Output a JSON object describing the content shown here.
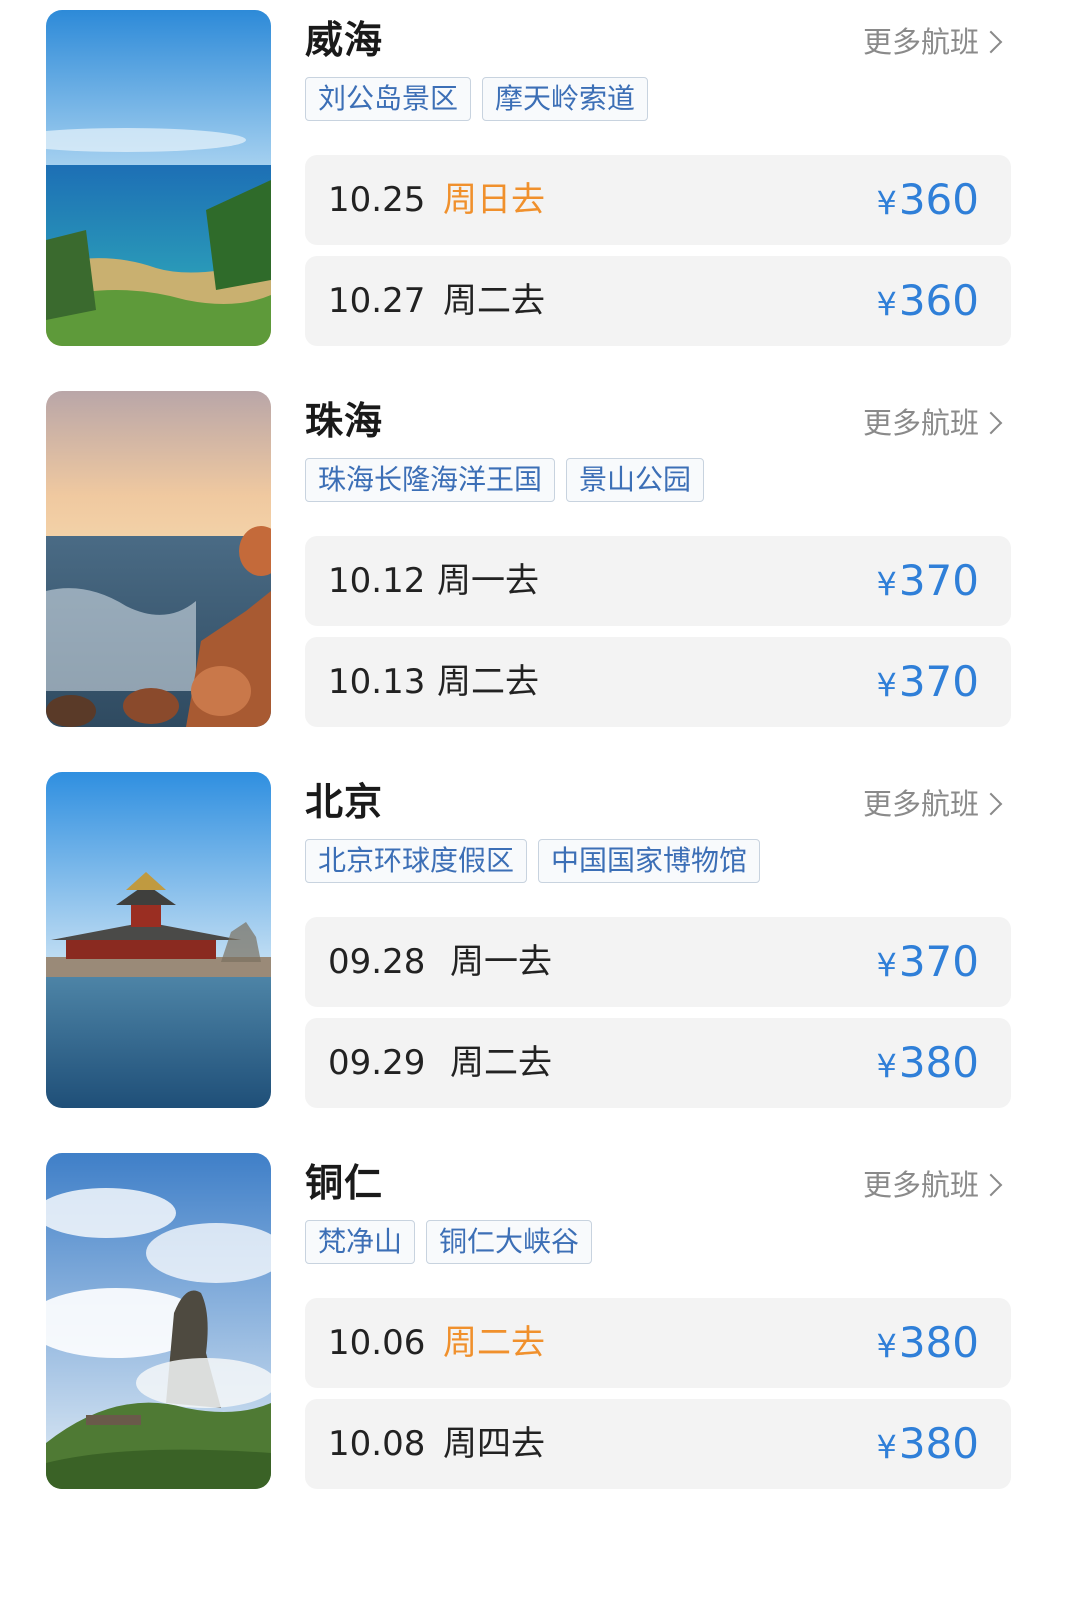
{
  "more_label": "更多航班",
  "colors": {
    "price": "#2f7fd8",
    "highlight_day": "#f0902c",
    "tag_text": "#3c6fb6"
  },
  "destinations": [
    {
      "city": "威海",
      "image": "seaside-coast-photo",
      "tags": [
        "刘公岛景区",
        "摩天岭索道"
      ],
      "flights": [
        {
          "date": "10.25",
          "day": "周日去",
          "highlight": true,
          "currency": "¥",
          "price": "360"
        },
        {
          "date": "10.27",
          "day": "周二去",
          "highlight": false,
          "currency": "¥",
          "price": "360"
        }
      ]
    },
    {
      "city": "珠海",
      "image": "rocky-shore-sunset-photo",
      "tags": [
        "珠海长隆海洋王国",
        "景山公园"
      ],
      "flights": [
        {
          "date": "10.12",
          "day": "周一去",
          "highlight": false,
          "currency": "¥",
          "price": "370"
        },
        {
          "date": "10.13",
          "day": "周二去",
          "highlight": false,
          "currency": "¥",
          "price": "370"
        }
      ]
    },
    {
      "city": "北京",
      "image": "forbidden-city-turret-photo",
      "tags": [
        "北京环球度假区",
        "中国国家博物馆"
      ],
      "flights": [
        {
          "date": "09.28",
          "day": "周一去",
          "highlight": false,
          "currency": "¥",
          "price": "370"
        },
        {
          "date": "09.29",
          "day": "周二去",
          "highlight": false,
          "currency": "¥",
          "price": "380"
        }
      ]
    },
    {
      "city": "铜仁",
      "image": "mountain-peak-clouds-photo",
      "tags": [
        "梵净山",
        "铜仁大峡谷"
      ],
      "flights": [
        {
          "date": "10.06",
          "day": "周二去",
          "highlight": true,
          "currency": "¥",
          "price": "380"
        },
        {
          "date": "10.08",
          "day": "周四去",
          "highlight": false,
          "currency": "¥",
          "price": "380"
        }
      ]
    }
  ]
}
